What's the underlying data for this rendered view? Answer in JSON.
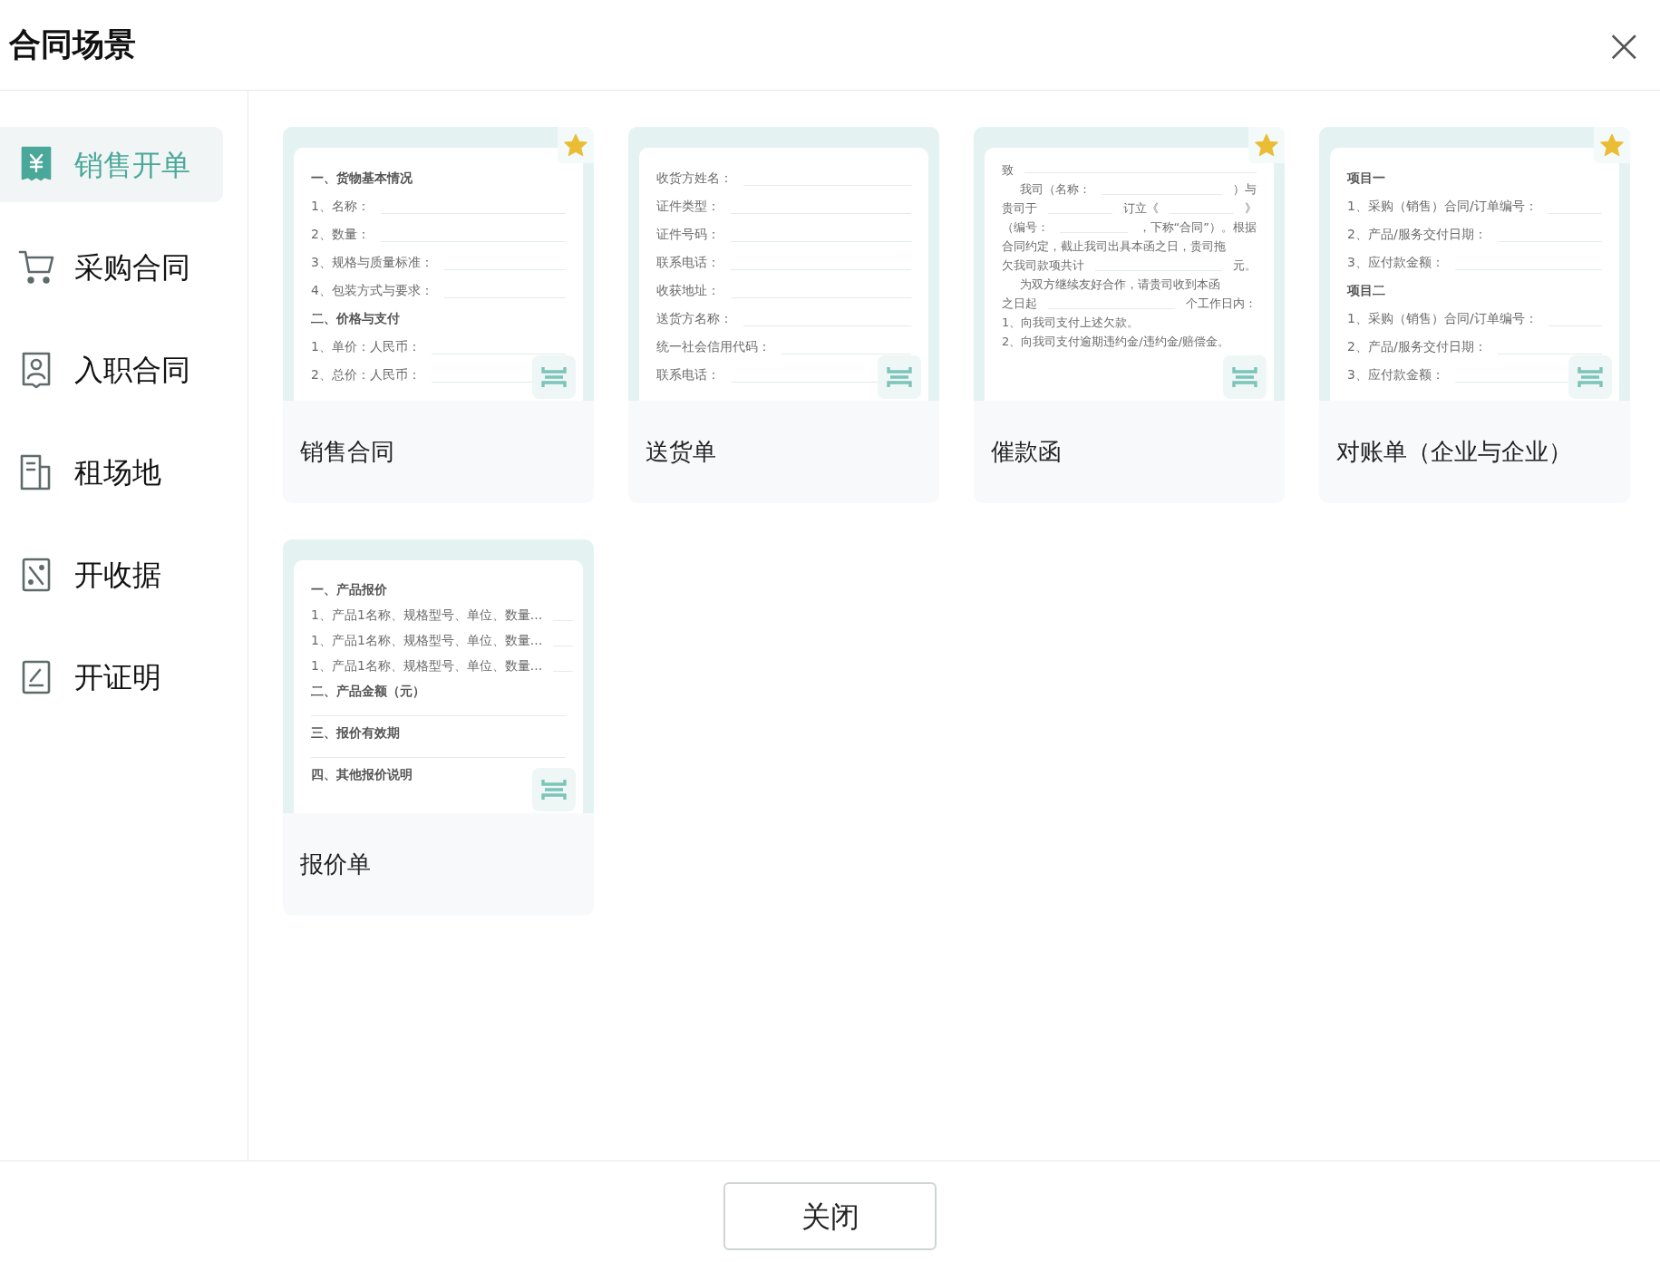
{
  "dialog": {
    "title": "合同场景",
    "close_symbol": "×"
  },
  "sidebar": {
    "items": [
      {
        "label": "销售开单",
        "selected": true
      },
      {
        "label": "采购合同",
        "selected": false
      },
      {
        "label": "入职合同",
        "selected": false
      },
      {
        "label": "租场地",
        "selected": false
      },
      {
        "label": "开收据",
        "selected": false
      },
      {
        "label": "开证明",
        "selected": false
      }
    ]
  },
  "templates": [
    {
      "title": "销售合同",
      "starred": true,
      "lines": [
        {
          "kind": "heading",
          "text": "一、货物基本情况"
        },
        {
          "kind": "field",
          "text": "1、名称："
        },
        {
          "kind": "field",
          "text": "2、数量："
        },
        {
          "kind": "field",
          "text": "3、规格与质量标准："
        },
        {
          "kind": "field",
          "text": "4、包装方式与要求："
        },
        {
          "kind": "heading",
          "text": "二、价格与支付"
        },
        {
          "kind": "field",
          "text": "1、单价：人民币："
        },
        {
          "kind": "field",
          "text": "2、总价：人民币："
        }
      ]
    },
    {
      "title": "送货单",
      "starred": false,
      "lines": [
        {
          "kind": "field",
          "text": "收货方姓名："
        },
        {
          "kind": "field",
          "text": "证件类型："
        },
        {
          "kind": "field",
          "text": "证件号码："
        },
        {
          "kind": "field",
          "text": "联系电话："
        },
        {
          "kind": "field",
          "text": "收获地址："
        },
        {
          "kind": "field",
          "text": "送货方名称："
        },
        {
          "kind": "field",
          "text": "统一社会信用代码："
        },
        {
          "kind": "field",
          "text": "联系电话："
        }
      ]
    },
    {
      "title": "催款函",
      "starred": true,
      "lines": [
        {
          "kind": "field",
          "text": "致"
        },
        {
          "kind": "indent_fill",
          "parts": [
            "我司（名称：",
            "）与"
          ]
        },
        {
          "kind": "fill",
          "parts": [
            "贵司于",
            "订立《",
            "》"
          ]
        },
        {
          "kind": "fill",
          "parts": [
            "（编号：",
            "，下称“合同”）。根据"
          ]
        },
        {
          "kind": "text",
          "text": "合同约定，截止我司出具本函之日，贵司拖"
        },
        {
          "kind": "fill",
          "parts": [
            "欠我司款项共计",
            "元。"
          ]
        },
        {
          "kind": "indent_text",
          "text": "为双方继续友好合作，请贵司收到本函"
        },
        {
          "kind": "fill",
          "parts": [
            "之日起",
            "个工作日内："
          ]
        },
        {
          "kind": "text",
          "text": "1、向我司支付上述欠款。"
        },
        {
          "kind": "text",
          "text": "2、向我司支付逾期违约金/违约金/赔偿金。"
        }
      ]
    },
    {
      "title": "对账单（企业与企业）",
      "starred": true,
      "lines": [
        {
          "kind": "heading",
          "text": "项目一"
        },
        {
          "kind": "field",
          "text": "1、采购（销售）合同/订单编号："
        },
        {
          "kind": "field",
          "text": "2、产品/服务交付日期："
        },
        {
          "kind": "field",
          "text": "3、应付款金额："
        },
        {
          "kind": "heading",
          "text": "项目二"
        },
        {
          "kind": "field",
          "text": "1、采购（销售）合同/订单编号："
        },
        {
          "kind": "field",
          "text": "2、产品/服务交付日期："
        },
        {
          "kind": "field",
          "text": "3、应付款金额："
        }
      ]
    },
    {
      "title": "报价单",
      "starred": false,
      "lines": [
        {
          "kind": "heading",
          "text": "一、产品报价"
        },
        {
          "kind": "field",
          "text": "1、产品1名称、规格型号、单位、数量..."
        },
        {
          "kind": "field",
          "text": "1、产品1名称、规格型号、单位、数量..."
        },
        {
          "kind": "field",
          "text": "1、产品1名称、规格型号、单位、数量..."
        },
        {
          "kind": "heading",
          "text": "二、产品金额（元）"
        },
        {
          "kind": "rule"
        },
        {
          "kind": "heading",
          "text": "三、报价有效期"
        },
        {
          "kind": "rule"
        },
        {
          "kind": "heading",
          "text": "四、其他报价说明"
        }
      ]
    }
  ],
  "footer": {
    "close_button": "关闭"
  }
}
